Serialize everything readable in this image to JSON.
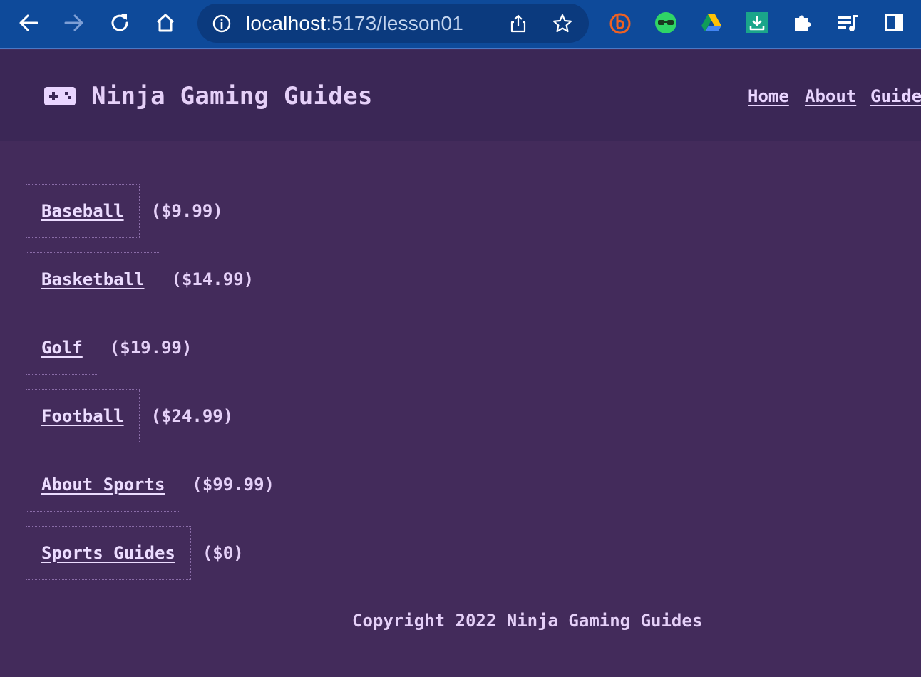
{
  "browser": {
    "url_host": "localhost",
    "url_path": ":5173/lesson01"
  },
  "header": {
    "logo_icon": "gamepad-icon",
    "title": "Ninja Gaming Guides",
    "nav": [
      "Home",
      "About",
      "Guides"
    ]
  },
  "guides": [
    {
      "name": "Baseball",
      "price": "($9.99)"
    },
    {
      "name": "Basketball",
      "price": "($14.99)"
    },
    {
      "name": "Golf",
      "price": "($19.99)"
    },
    {
      "name": "Football",
      "price": "($24.99)"
    },
    {
      "name": "About Sports",
      "price": "($99.99)"
    },
    {
      "name": "Sports Guides",
      "price": "($0)"
    }
  ],
  "footer": {
    "copyright": "Copyright 2022 Ninja Gaming Guides"
  },
  "colors": {
    "page_bg": "#432b5b",
    "header_bg": "#3b2756",
    "text": "#e9d5ff",
    "browser_bar": "#0e4a9a"
  }
}
